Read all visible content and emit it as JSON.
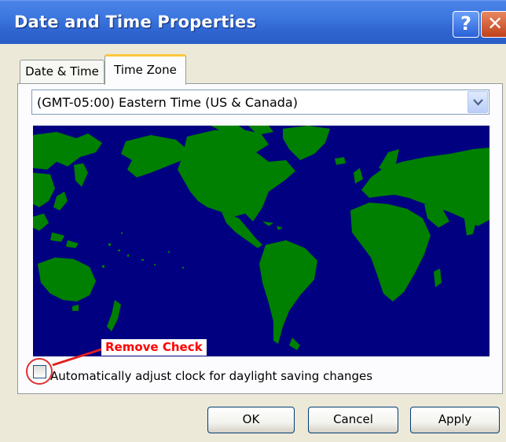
{
  "window": {
    "title": "Date and Time Properties",
    "help_button": "?",
    "close_button": "✕"
  },
  "tabs": [
    {
      "label": "Date & Time",
      "active": false
    },
    {
      "label": "Time Zone",
      "active": true
    }
  ],
  "timezone": {
    "selected": "(GMT-05:00) Eastern Time (US & Canada)"
  },
  "map": {
    "ocean_color": "#000080",
    "land_color": "#008000"
  },
  "annotation": {
    "text": "Remove Check",
    "color": "#ff0000"
  },
  "daylight": {
    "label": "Automatically adjust clock for daylight saving changes",
    "checked": false
  },
  "buttons": {
    "ok": "OK",
    "cancel": "Cancel",
    "apply": "Apply"
  }
}
